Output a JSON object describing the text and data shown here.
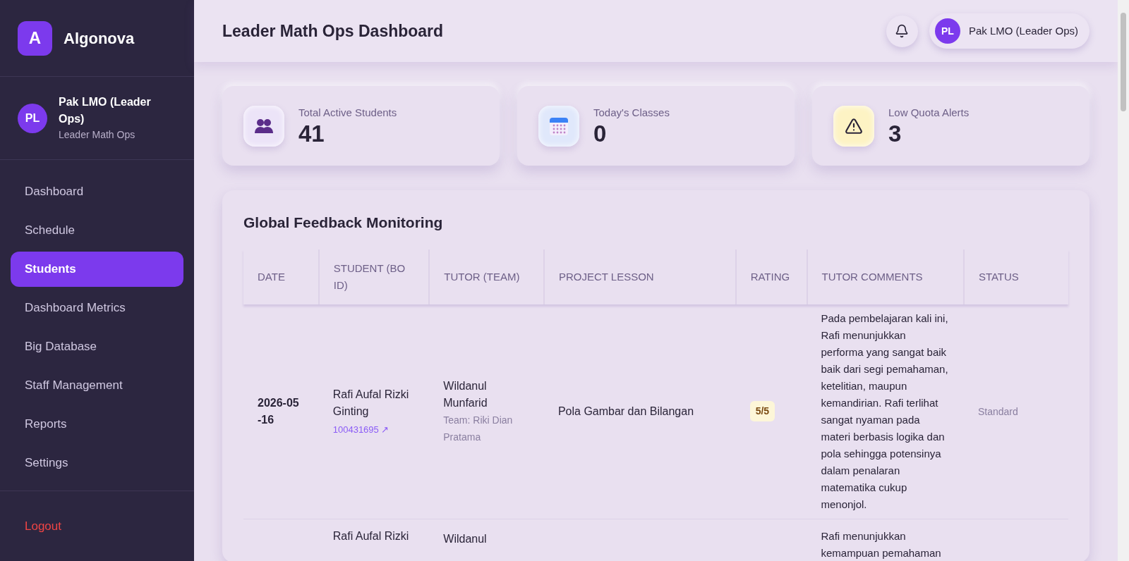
{
  "brand": {
    "logo_letter": "A",
    "name": "Algonova"
  },
  "user": {
    "initials": "PL",
    "name": "Pak LMO (Leader Ops)",
    "role": "Leader Math Ops"
  },
  "nav": [
    {
      "label": "Dashboard",
      "selected": false
    },
    {
      "label": "Schedule",
      "selected": false
    },
    {
      "label": "Students",
      "selected": true
    },
    {
      "label": "Dashboard Metrics",
      "selected": false
    },
    {
      "label": "Big Database",
      "selected": false
    },
    {
      "label": "Staff Management",
      "selected": false
    },
    {
      "label": "Reports",
      "selected": false
    },
    {
      "label": "Settings",
      "selected": false
    }
  ],
  "logout": "Logout",
  "header": {
    "title": "Leader Math Ops Dashboard",
    "user_initials": "PL",
    "user_name": "Pak LMO (Leader Ops)"
  },
  "stats": [
    {
      "kind": "students",
      "label": "Total Active Students",
      "value": "41"
    },
    {
      "kind": "classes",
      "label": "Today's Classes",
      "value": "0"
    },
    {
      "kind": "alerts",
      "label": "Low Quota Alerts",
      "value": "3"
    }
  ],
  "feedback": {
    "title": "Global Feedback Monitoring",
    "columns": [
      "DATE",
      "STUDENT (BO ID)",
      "TUTOR (TEAM)",
      "PROJECT LESSON",
      "RATING",
      "TUTOR COMMENTS",
      "STATUS"
    ],
    "rows": [
      {
        "date": "2026-05-16",
        "student": "Rafi Aufal Rizki Ginting",
        "bo_id": "100431695 ↗",
        "tutor": "Wildanul Munfarid",
        "team": "Team: Riki Dian Pratama",
        "lesson": "Pola Gambar dan Bilangan",
        "rating": "5/5",
        "comment": "Pada pembelajaran kali ini, Rafi menunjukkan performa yang sangat baik baik dari segi pemahaman, ketelitian, maupun kemandirian. Rafi terlihat sangat nyaman pada materi berbasis logika dan pola sehingga potensinya dalam penalaran matematika cukup menonjol.",
        "status": "Standard"
      },
      {
        "student": "Rafi Aufal Rizki",
        "tutor": "Wildanul",
        "comment": "Rafi menunjukkan kemampuan pemahaman"
      }
    ]
  }
}
